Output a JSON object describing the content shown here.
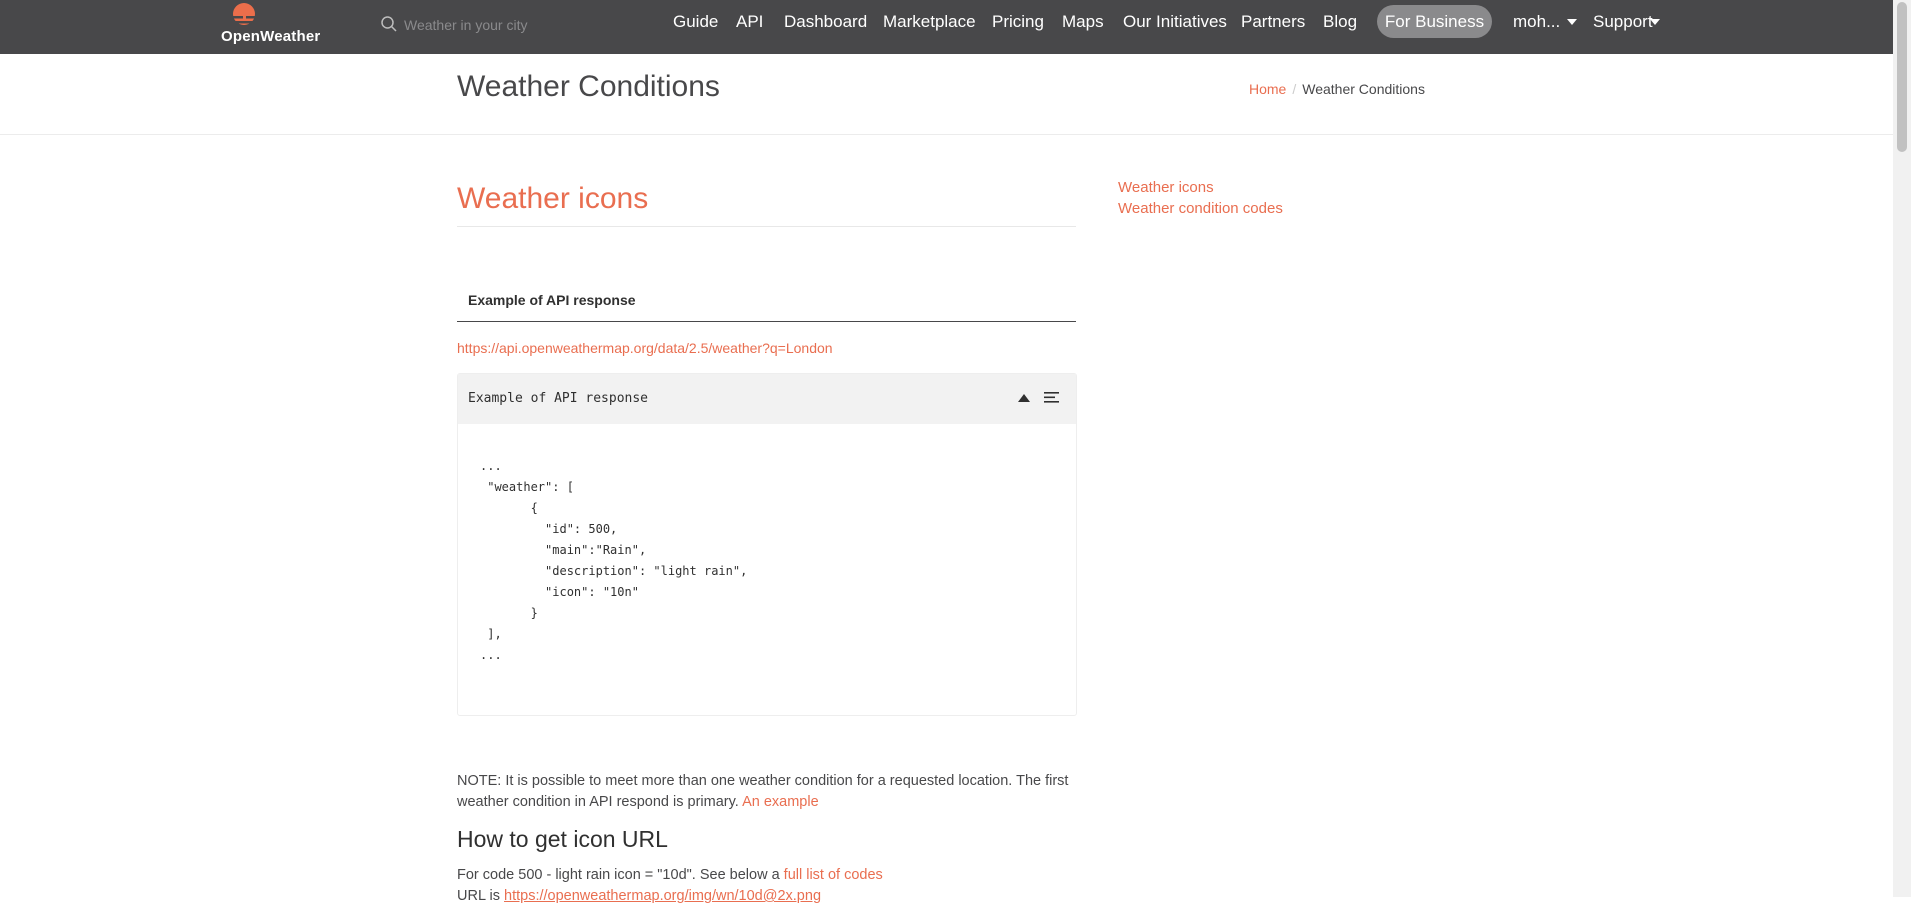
{
  "nav": {
    "logo_text": "OpenWeather",
    "search_placeholder": "Weather in your city",
    "links": [
      "Guide",
      "API",
      "Dashboard",
      "Marketplace",
      "Pricing",
      "Maps",
      "Our Initiatives",
      "Partners",
      "Blog"
    ],
    "for_business": "For Business",
    "user": "moh...",
    "support": "Support"
  },
  "header": {
    "title": "Weather Conditions",
    "breadcrumb_home": "Home",
    "breadcrumb_sep": "/",
    "breadcrumb_current": "Weather Conditions"
  },
  "main": {
    "section_title": "Weather icons",
    "tab_label": "Example of API response",
    "api_link": "https://api.openweathermap.org/data/2.5/weather?q=London",
    "code_header": "Example of API response",
    "code": "...\n \"weather\": [\n       {\n         \"id\": 500,\n         \"main\":\"Rain\",\n         \"description\": \"light rain\",\n         \"icon\": \"10n\"\n       }\n ],\n...",
    "note_text": "NOTE: It is possible to meet more than one weather condition for a requested location. The first weather condition in API respond is primary.",
    "note_link": "An example",
    "h2": "How to get icon URL",
    "p2_text": "For code 500 - light rain icon = \"10d\". See below a",
    "p2_link": "full list of codes",
    "p3_text": "URL is",
    "p3_link": "https://openweathermap.org/img/wn/10d@2x.png"
  },
  "toc": {
    "items": [
      "Weather icons",
      "Weather condition codes"
    ]
  },
  "colors": {
    "accent": "#e96e50",
    "nav_bg": "#48484a",
    "for_business_bg": "#8a8a8c"
  }
}
